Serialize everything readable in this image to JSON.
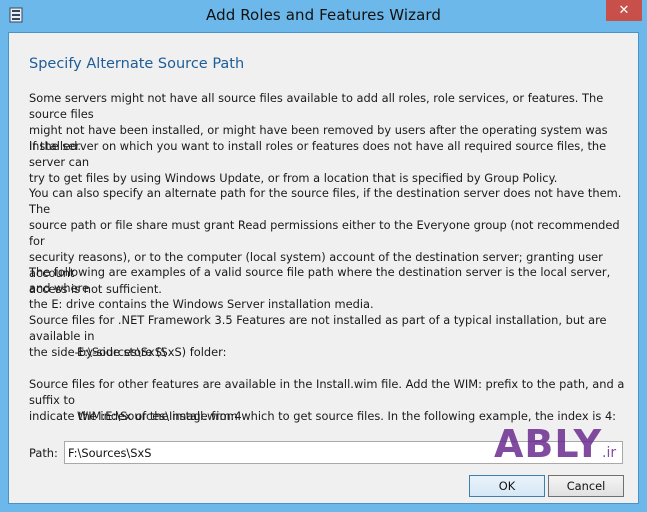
{
  "window": {
    "title": "Add Roles and Features Wizard",
    "close_glyph": "✕"
  },
  "page": {
    "heading": "Specify Alternate Source Path",
    "paragraphs": [
      "Some servers might not have all source files available to add all roles, role services, or features. The source files\nmight not have been installed, or might have been removed by users after the operating system was installed.",
      "If the server on which you want to install roles or features does not have all required source files, the server can\ntry to get files by using Windows Update, or from a location that is specified by Group Policy.",
      "You can also specify an alternate path for the source files, if the destination server does not have them. The\nsource path or file share must grant Read permissions either to the Everyone group (not recommended for\nsecurity reasons), or to the computer (local system) account of the destination server; granting user account\naccess is not sufficient.",
      "The following are examples of a valid source file path where the destination server is the local server, and where\nthe E: drive contains the Windows Server installation media.",
      "Source files for .NET Framework 3.5 Features are not installed as part of a typical installation, but are available in\nthe side-by-side store (SxS) folder:",
      "Source files for other features are available in the Install.wim file. Add the WIM: prefix to the path, and a suffix to\nindicate the index of the image from which to get source files. In the following example, the index is 4:"
    ],
    "example_sxs": "E:\\Sources\\SxS\\",
    "example_wim": "WIM:E:\\Sources\\Install.wim:4"
  },
  "path": {
    "label": "Path:",
    "value": "F:\\Sources\\SxS"
  },
  "watermark": {
    "text": "ABLY",
    "suffix": ".ir",
    "color": "#6b2d8f"
  },
  "buttons": {
    "ok": "OK",
    "cancel": "Cancel"
  },
  "colors": {
    "frame": "#6db8ea",
    "heading": "#1e5d98",
    "close": "#c7504b"
  },
  "icons": {
    "app": "server-manager-icon",
    "close": "close-icon"
  }
}
